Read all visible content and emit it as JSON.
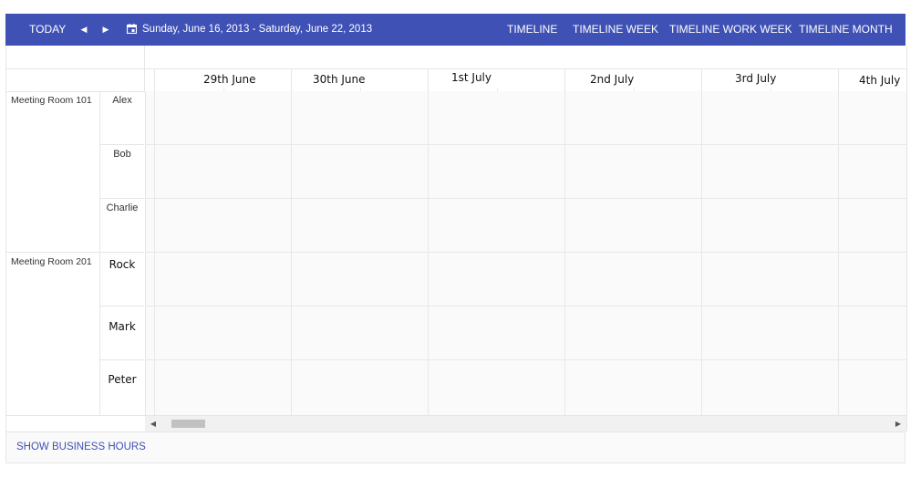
{
  "toolbar": {
    "today_label": "TODAY",
    "prev_icon": "chevron-left-icon",
    "next_icon": "chevron-right-icon",
    "calendar_icon": "calendar-icon",
    "date_range": "Sunday, June 16, 2013 - Saturday, June 22, 2013",
    "views": [
      "TIMELINE",
      "TIMELINE WEEK",
      "TIMELINE WORK WEEK",
      "TIMELINE MONTH"
    ]
  },
  "days": [
    "29th June",
    "30th June",
    "1st July",
    "2nd July",
    "3rd July",
    "4th July"
  ],
  "rooms": [
    {
      "name": "Meeting Room 101",
      "people": [
        "Alex",
        "Bob",
        "Charlie"
      ]
    },
    {
      "name": "Meeting Room 201",
      "people": [
        "Rock",
        "Mark",
        "Peter"
      ]
    }
  ],
  "footer": {
    "business_hours_label": "SHOW BUSINESS HOURS"
  },
  "colors": {
    "accent": "#3f51b5",
    "grid_line": "#e6e6e6",
    "cell_bg": "#fafafa"
  }
}
